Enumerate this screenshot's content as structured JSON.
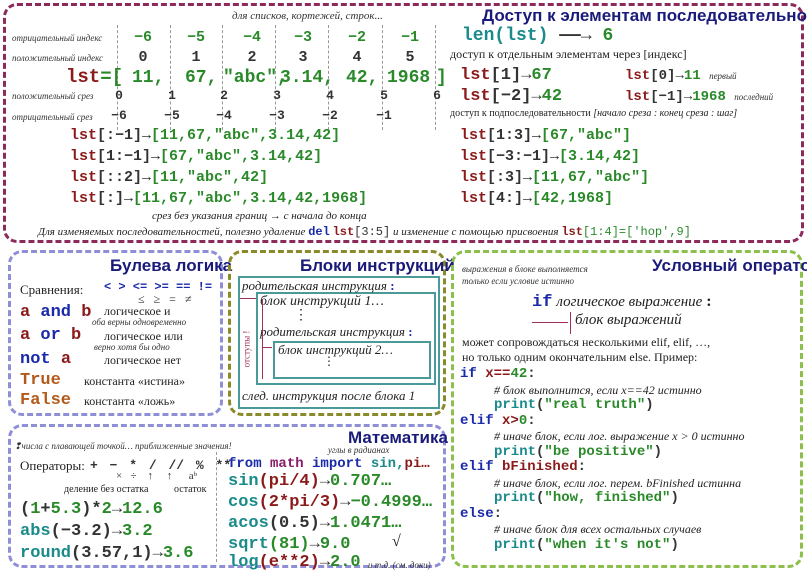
{
  "access": {
    "title": "Доступ к элементам последовательностей",
    "subtitle": "для списков, кортежей, строк...",
    "row_labels": {
      "neg_index": "отрицательный индекс",
      "pos_index": "положительный индекс",
      "pos_slice": "положительный срез",
      "neg_slice": "отрицательный срез"
    },
    "neg_index": [
      "−6",
      "−5",
      "−4",
      "−3",
      "−2",
      "−1"
    ],
    "pos_index": [
      "0",
      "1",
      "2",
      "3",
      "4",
      "5"
    ],
    "list_var": "lst",
    "list_eq": "=[",
    "list_items": [
      "11,",
      "67,",
      "\"abc\",",
      "3.14,",
      "42,",
      "1968"
    ],
    "list_close": "]",
    "pos_slice": [
      "0",
      "1",
      "2",
      "3",
      "4",
      "5",
      "6"
    ],
    "neg_slice": [
      "−6",
      "−5",
      "−4",
      "−3",
      "−2",
      "−1"
    ],
    "slices_left": [
      {
        "expr": "lst",
        "args": "[:−1]",
        "result": "[11,67,\"abc\",3.14,42]"
      },
      {
        "expr": "lst",
        "args": "[1:−1]",
        "result": "[67,\"abc\",3.14,42]"
      },
      {
        "expr": "lst",
        "args": "[::2]",
        "result": "[11,\"abc\",42]"
      },
      {
        "expr": "lst",
        "args": "[:]",
        "result": "[11,67,\"abc\",3.14,42,1968]"
      }
    ],
    "slice_note": "срез без указания границ → с начала до конца",
    "len_expr": "len(lst)",
    "len_result": "6",
    "index_heading": "доступ к отдельным элементам через [индекс]",
    "index_items": [
      {
        "expr": "lst",
        "args": "[1]",
        "result": "67"
      },
      {
        "expr": "lst",
        "args": "[−2]",
        "result": "42"
      },
      {
        "expr": "lst",
        "args": "[0]",
        "result": "11",
        "note": "первый"
      },
      {
        "expr": "lst",
        "args": "[−1]",
        "result": "1968",
        "note": "последний"
      }
    ],
    "subseq_heading": "доступ к подпоследовательности",
    "subseq_format": "[начало среза : конец среза : шаг]",
    "slices_right": [
      {
        "expr": "lst",
        "args": "[1:3]",
        "result": "[67,\"abc\"]"
      },
      {
        "expr": "lst",
        "args": "[−3:−1]",
        "result": "[3.14,42]"
      },
      {
        "expr": "lst",
        "args": "[:3]",
        "result": "[11,67,\"abc\"]"
      },
      {
        "expr": "lst",
        "args": "[4:]",
        "result": "[42,1968]"
      }
    ],
    "footer_text1": "Для изменяемых последовательностей, полезно удаление",
    "footer_del": "del",
    "footer_del_expr": "lst",
    "footer_del_args": "[3:5]",
    "footer_text2": "и изменение с помощью присвоения",
    "footer_assign_expr": "lst",
    "footer_assign_args": "[1:4]=['hop',9]",
    "arrow": "→"
  },
  "boolean": {
    "title": "Булева логика",
    "compare_label": "Сравнения:",
    "compare_ops": "< > <= >= == !=",
    "compare_math": "≤  ≥  =  ≠",
    "items": [
      {
        "code_a": "a",
        "code_op": "and",
        "code_b": "b",
        "desc": "логическое и",
        "sub": "оба верны одновременно"
      },
      {
        "code_a": "a",
        "code_op": "or",
        "code_b": "b",
        "desc": "логическое или",
        "sub": "верно хотя бы одно"
      },
      {
        "code_op": "not",
        "code_a": "a",
        "desc": "логическое нет"
      },
      {
        "code": "True",
        "desc": "константа «истина»"
      },
      {
        "code": "False",
        "desc": "константа «ложь»"
      }
    ]
  },
  "blocks": {
    "title": "Блоки инструкций",
    "parent1": "родительская инструкция",
    "colon": ":",
    "block1": "блок инструкций 1…",
    "parent2": "родительская инструкция",
    "block2": "блок инструкций 2…",
    "next": "след. инструкция после  блока 1",
    "indent_label": "отступы !",
    "dots": "⋮"
  },
  "conditional": {
    "title": "Условный оператор",
    "intro1": "выражения в блоке выполняется",
    "intro2": "только если условие истинно",
    "if_kw": "if",
    "if_expr": "логическое выражение",
    "colon": ":",
    "block_expr": "блок выражений",
    "desc1": "может сопровождаться несколькими elif, elif, …,",
    "desc2": "но только одним окончательним else. Пример:",
    "code": [
      {
        "kw": "if",
        "cond": "x==",
        "num": "42",
        "end": ":"
      },
      {
        "comment": "# блок выполнится, если x==42 истинно"
      },
      {
        "fn": "print",
        "open": "(",
        "str": "\"real truth\"",
        "close": ")"
      },
      {
        "kw": "elif",
        "cond": "x>",
        "num": "0",
        "end": ":"
      },
      {
        "comment": "# иначе блок, если лог. выражение x > 0 истинно"
      },
      {
        "fn": "print",
        "open": "(",
        "str": "\"be positive\"",
        "close": ")"
      },
      {
        "kw": "elif",
        "cond": "bFinished",
        "num": "",
        "end": ":"
      },
      {
        "comment": "# иначе блок, если лог. перем. bFinished истинна"
      },
      {
        "fn": "print",
        "open": "(",
        "str": "\"how, finished\"",
        "close": ")"
      },
      {
        "kw": "else",
        "cond": "",
        "num": "",
        "end": ":"
      },
      {
        "comment": "# иначе блок для всех остальных случаев"
      },
      {
        "fn": "print",
        "open": "(",
        "str": "\"when it's not\"",
        "close": ")"
      }
    ]
  },
  "math": {
    "title": "Математика",
    "float_note": "числа с плавающей точкой… приближенные значения!",
    "angles_note": "углы в радианах",
    "ops_label": "Операторы:",
    "ops": [
      "+",
      "−",
      "*",
      "/",
      "//",
      "%",
      "**"
    ],
    "ops_math": [
      "×",
      "÷",
      "↑",
      "↑",
      "aᵇ"
    ],
    "int_div_label": "деление без остатка",
    "mod_label": "остаток",
    "examples_left": [
      {
        "pre": "(",
        "a": "1",
        "op": "+",
        "b": "5.3",
        "post": ")*",
        "c": "2",
        "result": "12.6"
      },
      {
        "fn": "abs",
        "arg": "(−3.2)",
        "result": "3.2"
      },
      {
        "fn": "round",
        "arg": "(3.57,1)",
        "result": "3.6"
      }
    ],
    "import_from": "from",
    "import_mod": "math",
    "import_kw": "import",
    "import_names": "sin,",
    "import_more": "pi…",
    "examples_right": [
      {
        "fn": "sin",
        "arg": "(pi/4)",
        "result": "0.707…"
      },
      {
        "fn": "cos",
        "arg": "(2*pi/3)",
        "result": "−0.4999…"
      },
      {
        "fn": "acos",
        "arg": "(0.5)",
        "result": "1.0471…"
      },
      {
        "fn": "sqrt",
        "arg": "(81)",
        "result": "9.0",
        "mark": "√"
      },
      {
        "fn": "log",
        "arg": "(e**2)",
        "result": "2.0",
        "note": "и т.д. (см. доки)"
      }
    ]
  }
}
